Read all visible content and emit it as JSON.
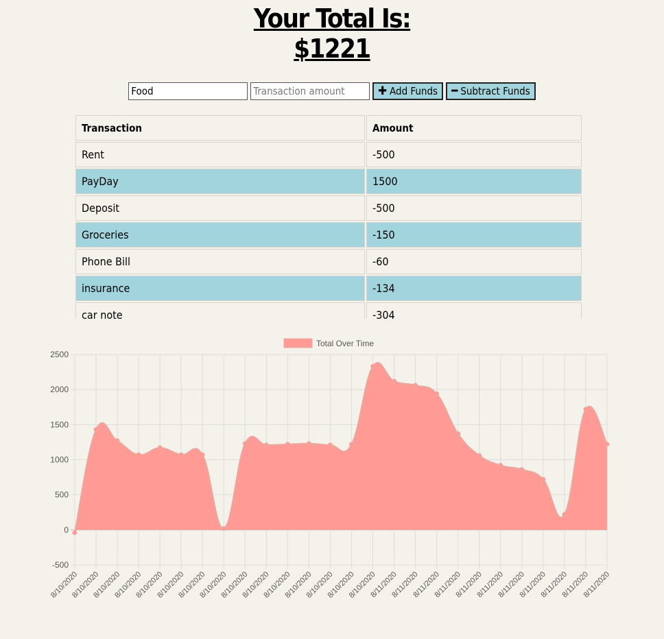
{
  "header": {
    "line1": "Your Total Is:",
    "line2": "$1221"
  },
  "form": {
    "name_value": "Food",
    "amount_placeholder": "Transaction amount",
    "add_label": "Add Funds",
    "subtract_label": "Subtract Funds"
  },
  "table": {
    "headers": [
      "Transaction",
      "Amount"
    ],
    "rows": [
      {
        "name": "Rent",
        "amount": "-500"
      },
      {
        "name": "PayDay",
        "amount": "1500"
      },
      {
        "name": "Deposit",
        "amount": "-500"
      },
      {
        "name": "Groceries",
        "amount": "-150"
      },
      {
        "name": "Phone Bill",
        "amount": "-60"
      },
      {
        "name": "insurance",
        "amount": "-134"
      },
      {
        "name": "car note",
        "amount": "-304"
      }
    ],
    "highlight_color": "#a1d4dc"
  },
  "chart_data": {
    "type": "area",
    "legend": "Total Over Time",
    "legend_position": "top",
    "fill_color": "#ff9b94",
    "line_color": "#e8a8a0",
    "grid": true,
    "ylim": [
      -500,
      2500
    ],
    "y_ticks": [
      2500,
      2000,
      1500,
      1000,
      500,
      0,
      -500
    ],
    "x": [
      "8/10/2020",
      "8/10/2020",
      "8/10/2020",
      "8/10/2020",
      "8/10/2020",
      "8/10/2020",
      "8/10/2020",
      "8/10/2020",
      "8/10/2020",
      "8/10/2020",
      "8/10/2020",
      "8/10/2020",
      "8/10/2020",
      "8/10/2020",
      "8/10/2020",
      "8/11/2020",
      "8/11/2020",
      "8/11/2020",
      "8/11/2020",
      "8/11/2020",
      "8/11/2020",
      "8/11/2020",
      "8/11/2020",
      "8/11/2020",
      "8/11/2020",
      "8/11/2020"
    ],
    "values": [
      -40,
      1430,
      1270,
      1070,
      1170,
      1070,
      1070,
      20,
      1230,
      1210,
      1220,
      1230,
      1210,
      1220,
      2330,
      2120,
      2060,
      1940,
      1370,
      1060,
      920,
      860,
      720,
      220,
      1720,
      1221
    ]
  }
}
